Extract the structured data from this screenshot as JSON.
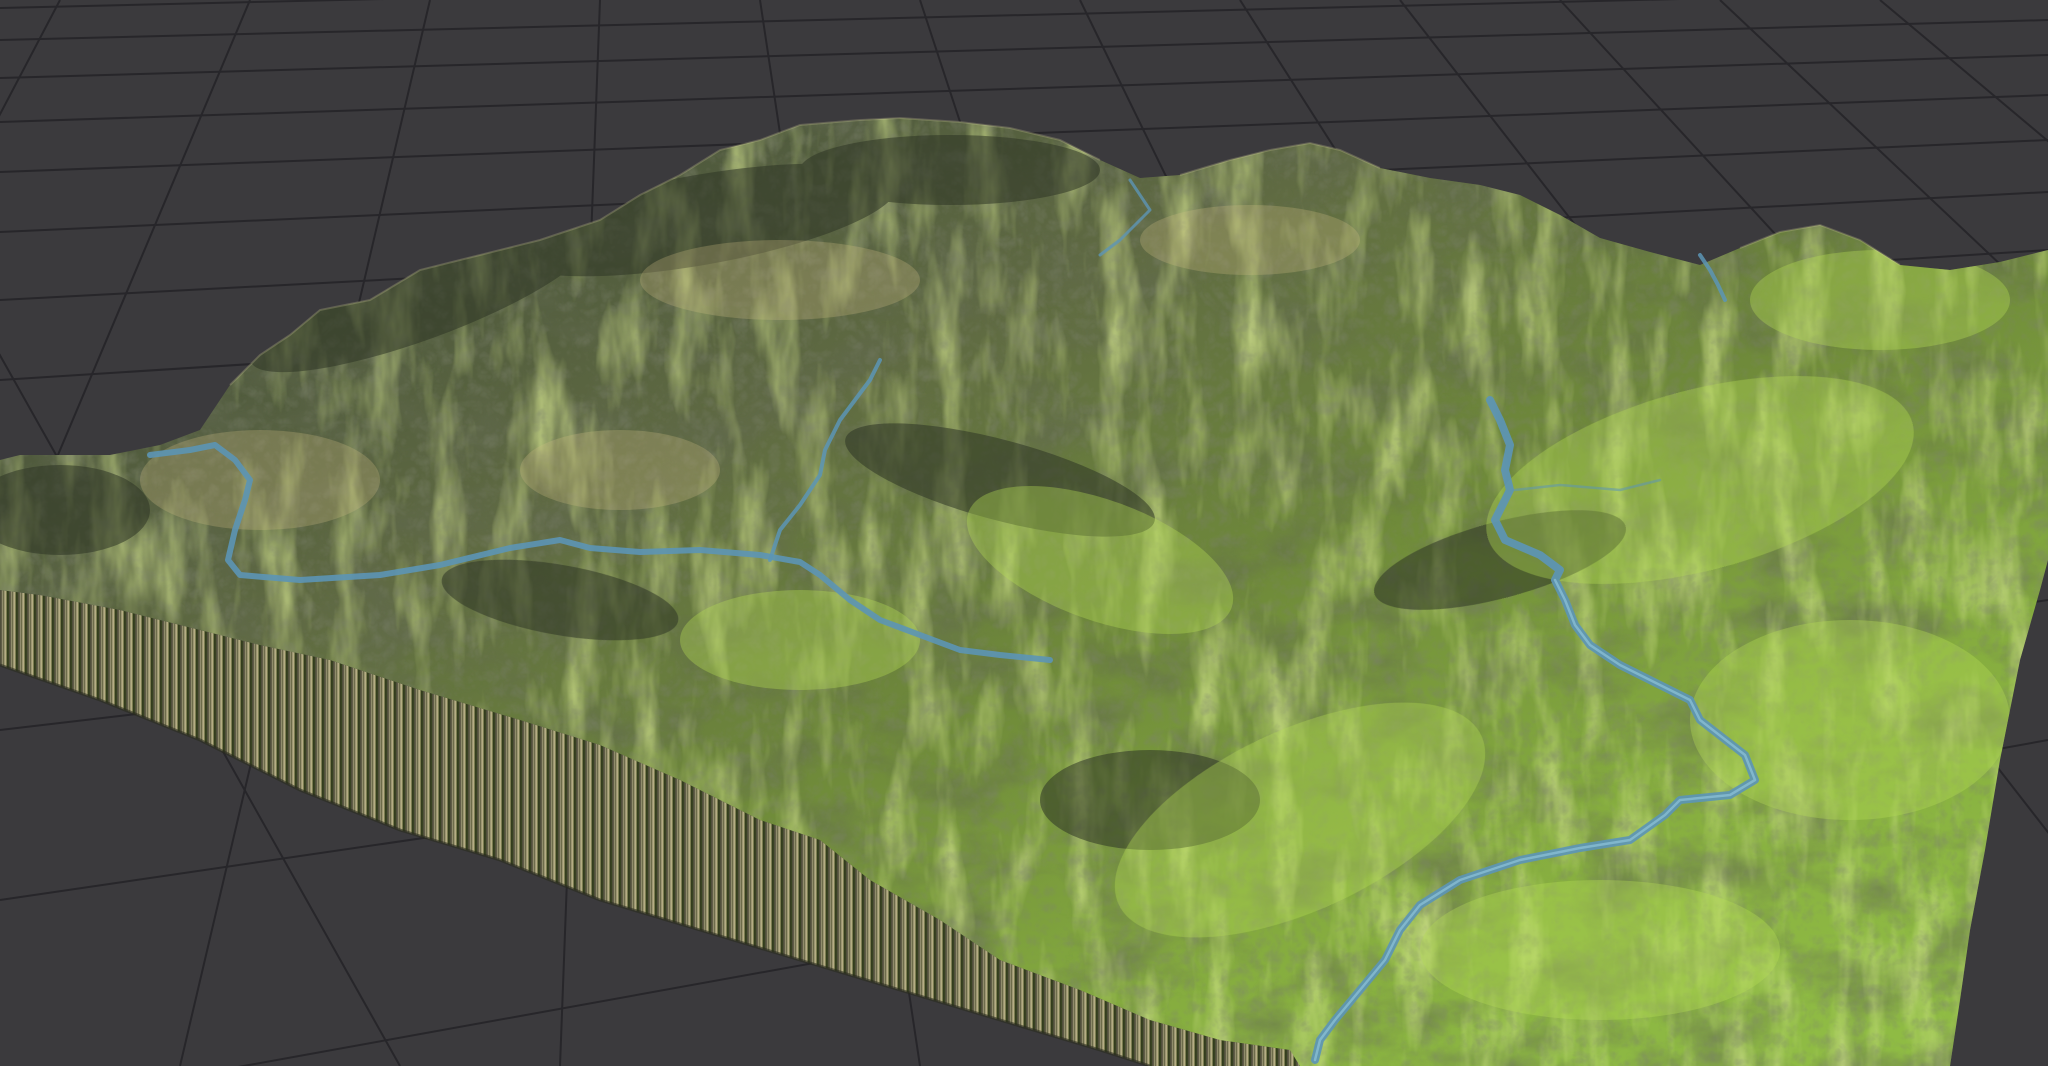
{
  "scene": {
    "background": "#3b3a3d",
    "grid_line_color": "#2a292c",
    "terrain": {
      "dark_rock": "#3a4232",
      "mid_rock": "#6b7350",
      "grass_light": "#9cc24a",
      "grass_bright": "#b6d95a",
      "dry_grass": "#b9b070",
      "cliff_light": "#b6ad8a",
      "cliff_dark": "#3e3f26"
    },
    "river_color": "#5c95b5",
    "river_highlight": "#8fc3d8"
  }
}
